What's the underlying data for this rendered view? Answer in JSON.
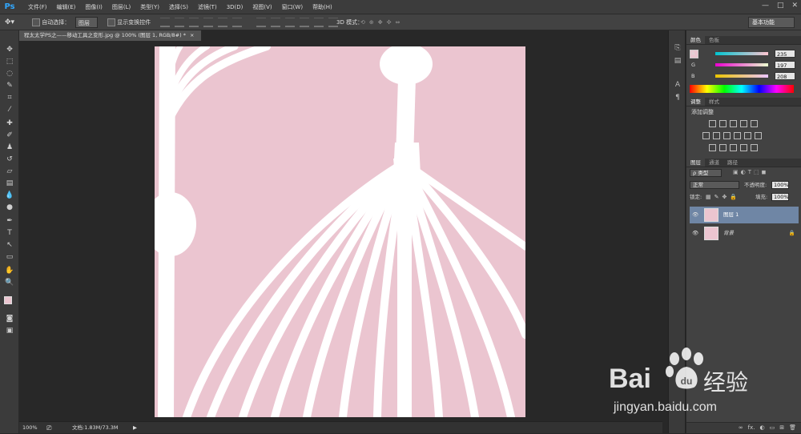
{
  "app": {
    "logo": "Ps",
    "menus": [
      "文件(F)",
      "编辑(E)",
      "图像(I)",
      "图层(L)",
      "类型(Y)",
      "选择(S)",
      "滤镜(T)",
      "3D(D)",
      "视图(V)",
      "窗口(W)",
      "帮助(H)"
    ],
    "window_controls": [
      "—",
      "□",
      "✕"
    ]
  },
  "options": {
    "auto_select_label": "自动选择：",
    "auto_select_value": "图层",
    "show_transform_label": "显示变换控件",
    "mode_3d_label": "3D 模式：",
    "workspace": "基本功能"
  },
  "document": {
    "tab_title": "程太太学PS之——移动工具之变形.jpg @ 100% (图层 1, RGB/8#) *",
    "tab_close": "×",
    "background_color": "#ebc5d0",
    "line_color": "#ffffff"
  },
  "status": {
    "zoom": "100%",
    "doc_info": "文档:1.83M/73.3M"
  },
  "color_panel": {
    "tabs": [
      "颜色",
      "色板"
    ],
    "r_label": "R",
    "r_value": "235",
    "g_label": "G",
    "g_value": "197",
    "b_label": "B",
    "b_value": "208",
    "foreground": "#ebc5d0",
    "background": "#000000"
  },
  "adjustments_panel": {
    "tabs": [
      "调整",
      "样式"
    ],
    "title": "添加调整"
  },
  "layers_panel": {
    "tabs": [
      "图层",
      "通道",
      "路径"
    ],
    "filter_kind": "ρ 类型",
    "blend_mode": "正常",
    "opacity_label": "不透明度:",
    "opacity_value": "100%",
    "lock_label": "锁定:",
    "fill_label": "填充:",
    "fill_value": "100%",
    "layers": [
      {
        "name": "图层 1",
        "selected": true,
        "locked": false
      },
      {
        "name": "背景",
        "selected": false,
        "locked": true
      }
    ],
    "bottom_icons": [
      "∞",
      "fx.",
      "◐",
      "▭",
      "⊞",
      "🗑"
    ]
  },
  "watermark": {
    "brand_left": "Bai",
    "brand_right": "经验",
    "url": "jingyan.baidu.com"
  }
}
